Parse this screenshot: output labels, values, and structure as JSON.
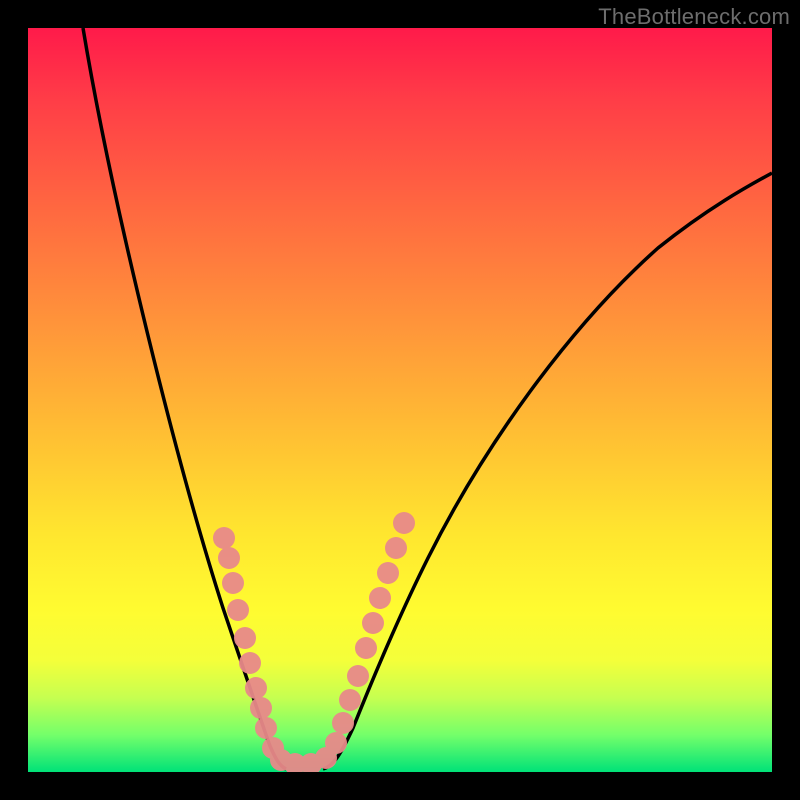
{
  "watermark": "TheBottleneck.com",
  "chart_data": {
    "type": "line",
    "title": "",
    "xlabel": "",
    "ylabel": "",
    "xlim": [
      0,
      100
    ],
    "ylim": [
      0,
      100
    ],
    "background_gradient": {
      "top_color": "#ff1a4a",
      "mid_color": "#ffe62f",
      "bottom_color": "#00e278",
      "meaning": "high (red) to low (green) bottleneck percentage"
    },
    "series": [
      {
        "name": "bottleneck-curve",
        "color": "#000000",
        "x": [
          7,
          10,
          15,
          20,
          25,
          28,
          30,
          32,
          34,
          36,
          38,
          40,
          45,
          50,
          55,
          60,
          70,
          80,
          90,
          100
        ],
        "y": [
          100,
          88,
          70,
          50,
          30,
          18,
          10,
          4,
          1,
          1,
          3,
          8,
          22,
          35,
          46,
          55,
          68,
          76,
          80,
          82
        ]
      }
    ],
    "scatter": {
      "name": "sample-points",
      "color": "#e88a8a",
      "x": [
        26,
        27,
        27.5,
        28,
        29,
        29.7,
        30.5,
        31.2,
        32,
        33,
        34,
        36,
        38,
        40,
        41.3,
        42.3,
        43.3,
        44.3,
        45.3,
        46.3,
        47.3,
        48.3,
        49.5,
        50.5
      ],
      "y": [
        31,
        29,
        25,
        22,
        18,
        15,
        11,
        9,
        6,
        3,
        2,
        1,
        1,
        2,
        4,
        7,
        10,
        13,
        17,
        20,
        23,
        27,
        30,
        33
      ]
    },
    "minimum_x": 35,
    "grid": false,
    "legend": false
  }
}
